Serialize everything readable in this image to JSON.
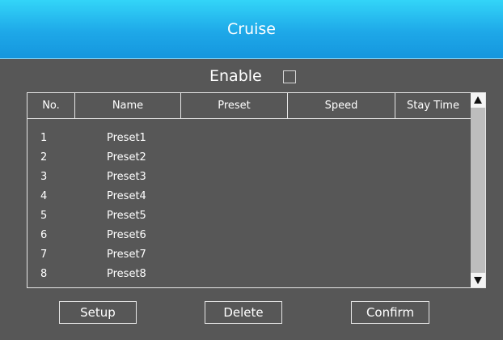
{
  "dialog": {
    "title": "Cruise",
    "enable_label": "Enable",
    "enable_checked": false
  },
  "table": {
    "columns": [
      "No.",
      "Name",
      "Preset",
      "Speed",
      "Stay Time"
    ],
    "rows": [
      {
        "no": "1",
        "name": "Preset1"
      },
      {
        "no": "2",
        "name": "Preset2"
      },
      {
        "no": "3",
        "name": "Preset3"
      },
      {
        "no": "4",
        "name": "Preset4"
      },
      {
        "no": "5",
        "name": "Preset5"
      },
      {
        "no": "6",
        "name": "Preset6"
      },
      {
        "no": "7",
        "name": "Preset7"
      },
      {
        "no": "8",
        "name": "Preset8"
      }
    ]
  },
  "buttons": {
    "setup": "Setup",
    "delete": "Delete",
    "confirm": "Confirm"
  },
  "icons": {
    "scroll_up": "triangle-up-icon",
    "scroll_down": "triangle-down-icon"
  },
  "colors": {
    "title_bar": "#1ea8e8",
    "dialog_background": "#575757"
  }
}
